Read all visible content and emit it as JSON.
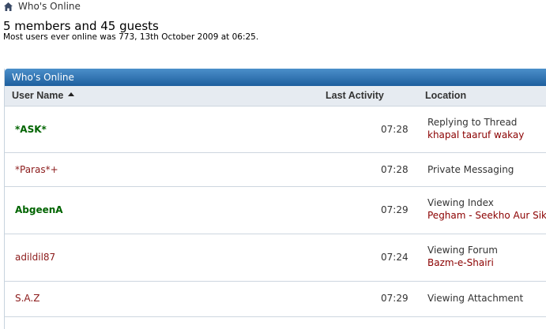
{
  "breadcrumb": {
    "label": "Who's Online"
  },
  "summary": {
    "title": "5 members and 45 guests",
    "record": "Most users ever online was 773, 13th October 2009 at 06:25."
  },
  "panel": {
    "title": "Who's Online",
    "columns": {
      "user": "User Name",
      "activity": "Last Activity",
      "location": "Location"
    }
  },
  "rows": [
    {
      "user": "*ASK*",
      "time": "07:28",
      "location": "Replying to Thread",
      "detail": "khapal taaruf wakay"
    },
    {
      "user": "*Paras*+",
      "time": "07:28",
      "location": "Private Messaging",
      "detail": ""
    },
    {
      "user": "AbgeenA",
      "time": "07:29",
      "location": "Viewing Index",
      "detail": "Pegham - Seekho Aur Sikh"
    },
    {
      "user": "adildil87",
      "time": "07:24",
      "location": "Viewing Forum",
      "detail": "Bazm-e-Shairi"
    },
    {
      "user": "S.A.Z",
      "time": "07:29",
      "location": "Viewing Attachment",
      "detail": ""
    }
  ],
  "colors": {
    "header": "#1e5f9e",
    "green_user": "#006400",
    "red_user": "#8b1a1a",
    "link": "#8b0000"
  }
}
